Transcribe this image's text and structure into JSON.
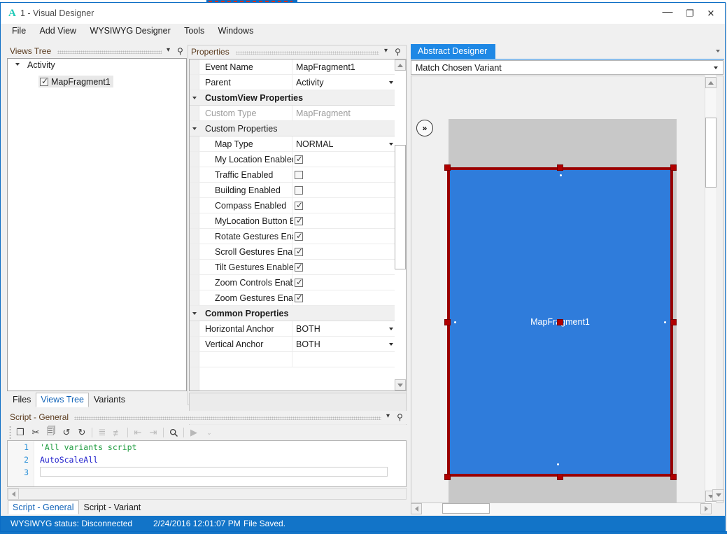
{
  "window": {
    "app_glyph": "A",
    "title": "1 - Visual Designer",
    "minimize": "—",
    "maximize": "❐",
    "close": "✕"
  },
  "menubar": {
    "items": [
      {
        "label": "File"
      },
      {
        "label": "Add View"
      },
      {
        "label": "WYSIWYG Designer"
      },
      {
        "label": "Tools"
      },
      {
        "label": "Windows"
      }
    ]
  },
  "views_tree": {
    "title": "Views Tree",
    "caret": "▾",
    "pin": "⚲",
    "root": {
      "label": "Activity"
    },
    "child": {
      "label": "MapFragment1",
      "checked": true
    }
  },
  "left_tabs": [
    {
      "label": "Files",
      "active": false
    },
    {
      "label": "Views Tree",
      "active": true
    },
    {
      "label": "Variants",
      "active": false
    }
  ],
  "properties": {
    "title": "Properties",
    "caret": "▾",
    "pin": "⚲",
    "rows": [
      {
        "kind": "prop",
        "name": "Event Name",
        "value": "MapFragment1",
        "control": "text"
      },
      {
        "kind": "prop",
        "name": "Parent",
        "value": "Activity",
        "control": "dropdown"
      },
      {
        "kind": "cat",
        "name": "CustomView Properties"
      },
      {
        "kind": "prop",
        "name": "Custom Type",
        "value": "MapFragment",
        "control": "text",
        "disabled": true
      },
      {
        "kind": "cat",
        "name": "Custom Properties",
        "sub": true
      },
      {
        "kind": "prop",
        "name": "Map Type",
        "value": "NORMAL",
        "control": "dropdown",
        "indent": 1
      },
      {
        "kind": "prop",
        "name": "My Location Enabled",
        "control": "checkbox",
        "checked": true,
        "indent": 1
      },
      {
        "kind": "prop",
        "name": "Traffic Enabled",
        "control": "checkbox",
        "checked": false,
        "indent": 1
      },
      {
        "kind": "prop",
        "name": "Building Enabled",
        "control": "checkbox",
        "checked": false,
        "indent": 1
      },
      {
        "kind": "prop",
        "name": "Compass Enabled",
        "control": "checkbox",
        "checked": true,
        "indent": 1
      },
      {
        "kind": "prop",
        "name": "MyLocation Button Enabled",
        "control": "checkbox",
        "checked": true,
        "indent": 1
      },
      {
        "kind": "prop",
        "name": "Rotate Gestures Enabled",
        "control": "checkbox",
        "checked": true,
        "indent": 1
      },
      {
        "kind": "prop",
        "name": "Scroll Gestures Enabled",
        "control": "checkbox",
        "checked": true,
        "indent": 1
      },
      {
        "kind": "prop",
        "name": "Tilt Gestures Enabled",
        "control": "checkbox",
        "checked": true,
        "indent": 1
      },
      {
        "kind": "prop",
        "name": "Zoom Controls Enabled",
        "control": "checkbox",
        "checked": true,
        "indent": 1
      },
      {
        "kind": "prop",
        "name": "Zoom Gestures Enabled",
        "control": "checkbox",
        "checked": true,
        "indent": 1
      },
      {
        "kind": "cat",
        "name": "Common Properties"
      },
      {
        "kind": "prop",
        "name": "Horizontal Anchor",
        "value": "BOTH",
        "control": "dropdown"
      },
      {
        "kind": "prop",
        "name": "Vertical Anchor",
        "value": "BOTH",
        "control": "dropdown"
      }
    ]
  },
  "script": {
    "title": "Script - General",
    "caret": "▾",
    "pin": "⚲",
    "toolbar": [
      {
        "icon": "copy-icon",
        "glyph": "❐",
        "dim": false
      },
      {
        "icon": "cut-icon",
        "glyph": "✂",
        "dim": false
      },
      {
        "icon": "paste-icon",
        "glyph": "🗐",
        "dim": false
      },
      {
        "icon": "undo-icon",
        "glyph": "↺",
        "dim": false
      },
      {
        "icon": "redo-icon",
        "glyph": "↻",
        "dim": false
      },
      {
        "icon": "sep",
        "glyph": "",
        "dim": true
      },
      {
        "icon": "comment-icon",
        "glyph": "≣",
        "dim": true
      },
      {
        "icon": "uncomment-icon",
        "glyph": "≢",
        "dim": true
      },
      {
        "icon": "sep",
        "glyph": "",
        "dim": true
      },
      {
        "icon": "outdent-icon",
        "glyph": "⇤",
        "dim": true
      },
      {
        "icon": "indent-icon",
        "glyph": "⇥",
        "dim": true
      },
      {
        "icon": "sep",
        "glyph": "",
        "dim": true
      },
      {
        "icon": "search-icon",
        "glyph": "🔍",
        "dim": false
      },
      {
        "icon": "sep",
        "glyph": "",
        "dim": true
      },
      {
        "icon": "run-icon",
        "glyph": "▶",
        "dim": true
      }
    ],
    "lines": [
      {
        "num": "1",
        "text": "'All variants script",
        "style": "comment"
      },
      {
        "num": "2",
        "text": "AutoScaleAll",
        "style": "keyword"
      },
      {
        "num": "3",
        "text": "",
        "style": "plain"
      }
    ]
  },
  "script_tabs": [
    {
      "label": "Script - General",
      "active": true
    },
    {
      "label": "Script - Variant",
      "active": false
    }
  ],
  "designer": {
    "tab": "Abstract Designer",
    "tab_caret": "▾",
    "variant_selector": "Match Chosen Variant",
    "variant_caret": "▾",
    "expand_button": "»",
    "selected_view_label": "MapFragment1",
    "colors": {
      "selection_border": "#990000",
      "view_fill": "#2f7cdb",
      "plate": "#c8c8c8",
      "accent": "#1e88e5"
    }
  },
  "statusbar": {
    "wysiwyg_status": "WYSIWYG status: Disconnected",
    "timestamp": "2/24/2016 12:01:07 PM",
    "file_status": "File Saved."
  }
}
